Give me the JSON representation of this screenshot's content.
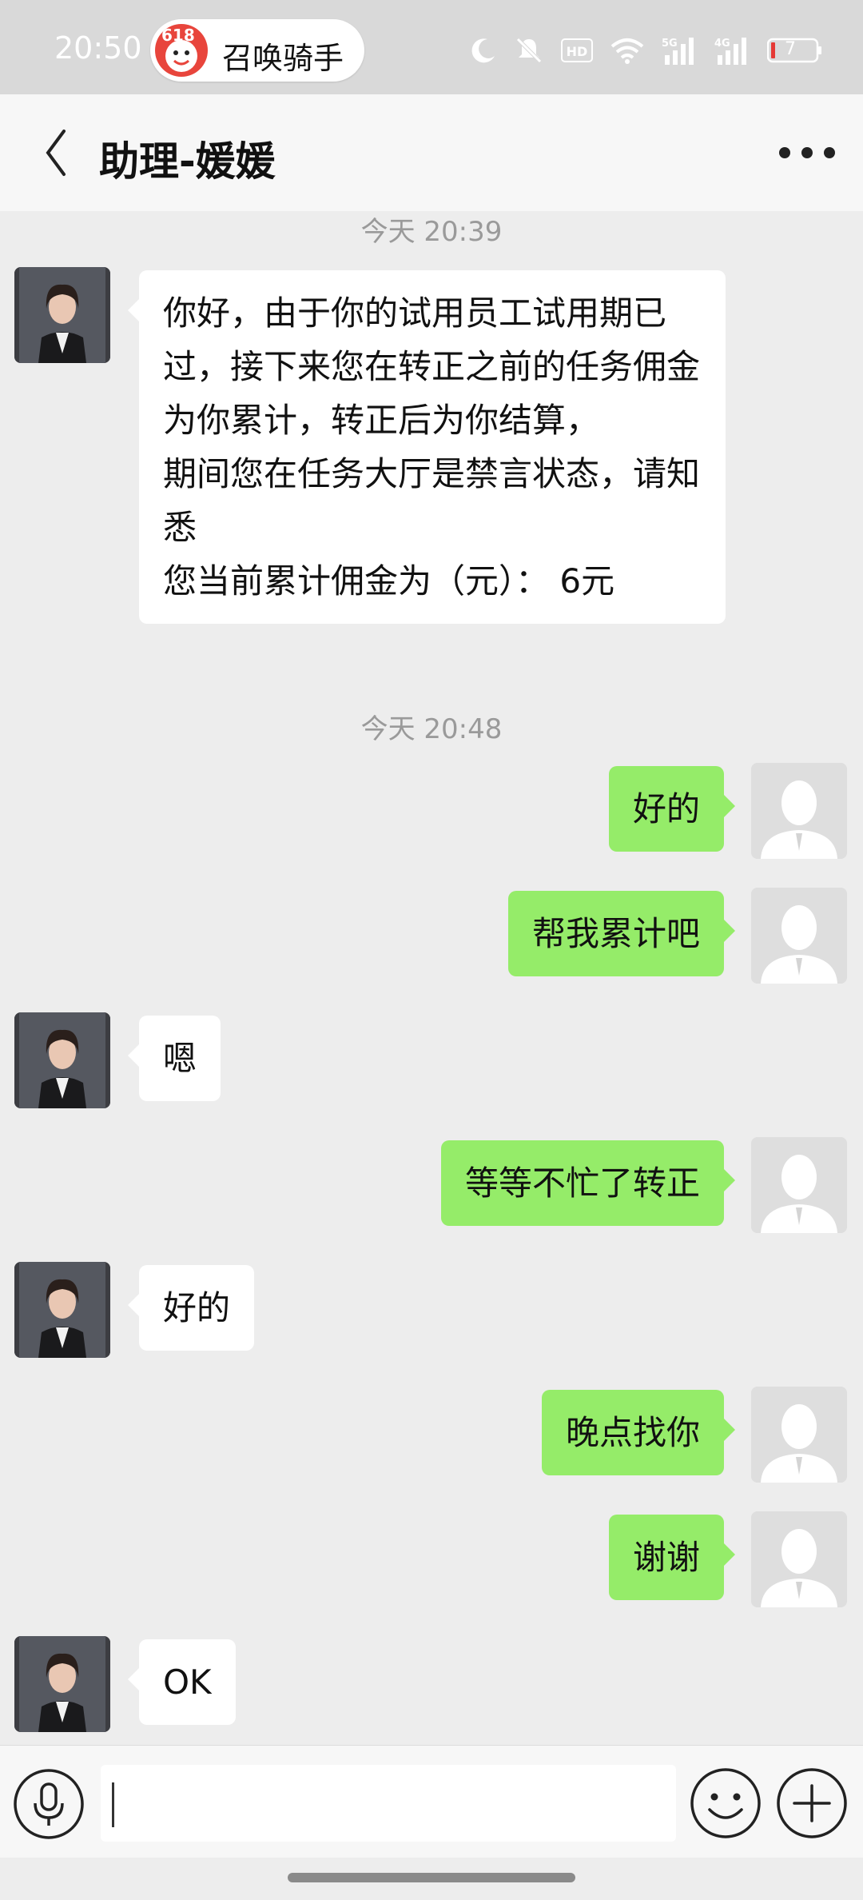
{
  "status_bar": {
    "time": "20:50",
    "notification_app": "召唤骑手",
    "notification_badge": "618",
    "battery_level": "7",
    "icons": [
      "moon-icon",
      "mute-icon",
      "hd-icon",
      "wifi-icon",
      "signal-5g-icon",
      "signal-4g-icon",
      "battery-icon"
    ]
  },
  "nav": {
    "title": "助理-媛媛",
    "back_icon": "back-arrow-icon",
    "more_icon": "more-dots-icon"
  },
  "chat": {
    "timestamps": [
      "今天 20:39",
      "今天 20:48"
    ],
    "messages": [
      {
        "side": "left",
        "text": "你好，由于你的试用员工试用期已过，接下来您在转正之前的任务佣金为你累计，转正后为你结算，\n期间您在任务大厅是禁言状态，请知悉\n 您当前累计佣金为（元）： 6元"
      },
      {
        "side": "right",
        "text": "好的"
      },
      {
        "side": "right",
        "text": "帮我累计吧"
      },
      {
        "side": "left",
        "text": "嗯"
      },
      {
        "side": "right",
        "text": "等等不忙了转正"
      },
      {
        "side": "left",
        "text": "好的"
      },
      {
        "side": "right",
        "text": "晚点找你"
      },
      {
        "side": "right",
        "text": "谢谢"
      },
      {
        "side": "left",
        "text": "OK"
      }
    ]
  },
  "input_bar": {
    "value": "",
    "icons": [
      "voice-icon",
      "emoji-icon",
      "plus-icon"
    ]
  },
  "colors": {
    "sent_bubble": "#95ec69",
    "received_bubble": "#ffffff",
    "background": "#ededed"
  }
}
